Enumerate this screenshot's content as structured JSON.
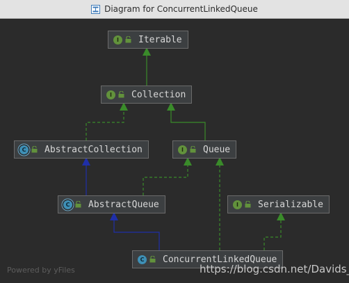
{
  "window": {
    "title": "Diagram for ConcurrentLinkedQueue"
  },
  "nodes": {
    "iterable": {
      "label": "Iterable",
      "kind": "interface",
      "badge": "I"
    },
    "collection": {
      "label": "Collection",
      "kind": "interface",
      "badge": "I"
    },
    "abstract_collection": {
      "label": "AbstractCollection",
      "kind": "abstract-class",
      "badge": "C"
    },
    "queue": {
      "label": "Queue",
      "kind": "interface",
      "badge": "I"
    },
    "abstract_queue": {
      "label": "AbstractQueue",
      "kind": "abstract-class",
      "badge": "C"
    },
    "serializable": {
      "label": "Serializable",
      "kind": "interface",
      "badge": "I"
    },
    "concurrent_linked_queue": {
      "label": "ConcurrentLinkedQueue",
      "kind": "class",
      "badge": "C"
    }
  },
  "edges": [
    {
      "from": "Collection",
      "to": "Iterable",
      "type": "extends"
    },
    {
      "from": "AbstractCollection",
      "to": "Collection",
      "type": "implements"
    },
    {
      "from": "Queue",
      "to": "Collection",
      "type": "extends"
    },
    {
      "from": "AbstractQueue",
      "to": "AbstractCollection",
      "type": "extends"
    },
    {
      "from": "AbstractQueue",
      "to": "Queue",
      "type": "implements"
    },
    {
      "from": "ConcurrentLinkedQueue",
      "to": "AbstractQueue",
      "type": "extends"
    },
    {
      "from": "ConcurrentLinkedQueue",
      "to": "Queue",
      "type": "implements"
    },
    {
      "from": "ConcurrentLinkedQueue",
      "to": "Serializable",
      "type": "implements"
    }
  ],
  "colors": {
    "interface_edge": "#3a8b2a",
    "class_edge": "#1f2fa8",
    "interface_badge": "#62923c",
    "class_badge": "#3e8fb5"
  },
  "footer": {
    "text": "Powered by yFiles"
  },
  "watermark": {
    "text": "https://blog.csdn.net/Davids_"
  }
}
